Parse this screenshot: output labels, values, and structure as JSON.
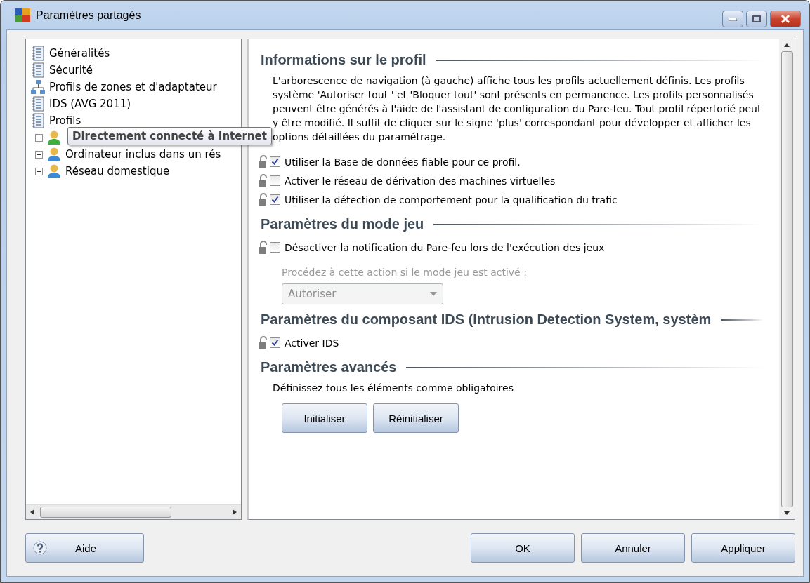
{
  "window": {
    "title": "Paramètres partagés"
  },
  "tree": {
    "items": [
      {
        "label": "Généralités",
        "kind": "document"
      },
      {
        "label": "Sécurité",
        "kind": "document"
      },
      {
        "label": "Profils de zones et d'adaptateur",
        "kind": "network"
      },
      {
        "label": "IDS (AVG 2011)",
        "kind": "document"
      },
      {
        "label": "Profils",
        "kind": "document",
        "children": [
          {
            "label": "Directement connecté à Internet",
            "kind": "profile",
            "active": true,
            "expanded": false,
            "hovered": true
          },
          {
            "label": "Ordinateur inclus dans un rés",
            "kind": "profile",
            "active": false,
            "expanded": false,
            "hovered": false
          },
          {
            "label": "Réseau domestique",
            "kind": "profile",
            "active": false,
            "expanded": false,
            "hovered": false
          }
        ]
      }
    ]
  },
  "content": {
    "sections": [
      {
        "heading": "Informations sur le profil",
        "items": [
          {
            "kind": "paragraph",
            "text": "L'arborescence de navigation (à gauche) affiche tous les profils actuellement définis. Les profils système 'Autoriser tout ' et 'Bloquer tout' sont présents en permanence. Les profils personnalisés peuvent être générés à l'aide de l'assistant de configuration du Pare-feu. Tout profil répertorié peut y être modifié. Il suffit de cliquer sur le signe 'plus' correspondant pour développer et afficher les options détaillées du paramétrage."
          },
          {
            "kind": "checkbox",
            "label": "Utiliser la Base de données fiable pour ce profil.",
            "checked": true
          },
          {
            "kind": "checkbox",
            "label": "Activer le réseau de dérivation des machines virtuelles",
            "checked": false
          },
          {
            "kind": "checkbox",
            "label": "Utiliser la détection de comportement pour la qualification du trafic",
            "checked": true
          }
        ]
      },
      {
        "heading": "Paramètres du mode jeu",
        "items": [
          {
            "kind": "checkbox",
            "label": "Désactiver la notification du Pare-feu lors de l'exécution des jeux",
            "checked": false
          },
          {
            "kind": "label",
            "text": "Procédez à cette action si le mode jeu est activé :",
            "disabled": true
          },
          {
            "kind": "select",
            "value": "Autoriser",
            "disabled": true
          }
        ]
      },
      {
        "heading": "Paramètres du composant IDS (Intrusion Detection System, systèm",
        "items": [
          {
            "kind": "checkbox",
            "label": "Activer IDS",
            "checked": true
          }
        ]
      },
      {
        "heading": "Paramètres avancés",
        "items": [
          {
            "kind": "paragraph",
            "text": "Définissez tous les éléments comme obligatoires"
          },
          {
            "kind": "buttons",
            "labels": [
              "Initialiser",
              "Réinitialiser"
            ]
          }
        ]
      }
    ]
  },
  "footer": {
    "help": "Aide",
    "buttons": [
      "OK",
      "Annuler",
      "Appliquer"
    ]
  }
}
